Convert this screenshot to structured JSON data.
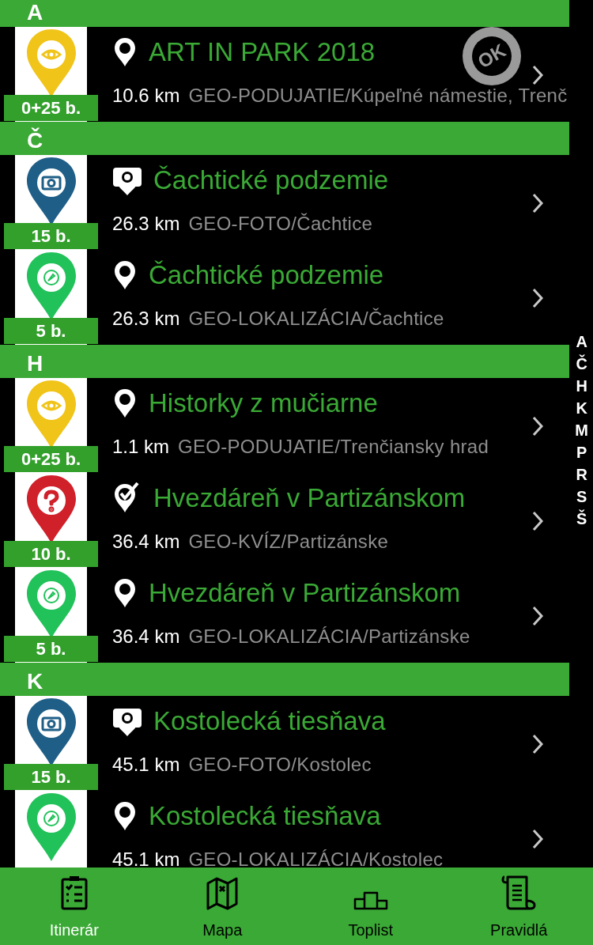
{
  "sections": [
    {
      "letter": "A",
      "items": [
        {
          "kind": "event",
          "points": "0+25 b.",
          "title": "ART IN PARK 2018",
          "distance": "10.6 km",
          "category": "GEO-PODUJATIE/Kúpeľné námestie, Trenč",
          "stamp": "OK"
        }
      ]
    },
    {
      "letter": "Č",
      "items": [
        {
          "kind": "photo",
          "points": "15 b.",
          "title": "Čachtické podzemie",
          "distance": "26.3 km",
          "category": "GEO-FOTO/Čachtice"
        },
        {
          "kind": "location",
          "points": "5 b.",
          "title": "Čachtické podzemie",
          "distance": "26.3 km",
          "category": "GEO-LOKALIZÁCIA/Čachtice"
        }
      ]
    },
    {
      "letter": "H",
      "items": [
        {
          "kind": "event",
          "points": "0+25 b.",
          "title": "Historky z mučiarne",
          "distance": "1.1 km",
          "category": "GEO-PODUJATIE/Trenčiansky hrad"
        },
        {
          "kind": "quiz",
          "points": "10 b.",
          "title": "Hvezdáreň v Partizánskom",
          "distance": "36.4 km",
          "category": "GEO-KVÍZ/Partizánske"
        },
        {
          "kind": "location",
          "points": "5 b.",
          "title": "Hvezdáreň v Partizánskom",
          "distance": "36.4 km",
          "category": "GEO-LOKALIZÁCIA/Partizánske"
        }
      ]
    },
    {
      "letter": "K",
      "items": [
        {
          "kind": "photo",
          "points": "15 b.",
          "title": "Kostolecká tiesňava",
          "distance": "45.1 km",
          "category": "GEO-FOTO/Kostolec"
        },
        {
          "kind": "location",
          "title": "Kostolecká tiesňava",
          "distance": "45.1 km",
          "category": "GEO-LOKALIZÁCIA/Kostolec"
        }
      ]
    }
  ],
  "index": [
    "A",
    "Č",
    "H",
    "K",
    "M",
    "P",
    "R",
    "S",
    "Š"
  ],
  "tabs": [
    {
      "kind": "itinerary",
      "label": "Itinerár",
      "selected": true
    },
    {
      "kind": "map",
      "label": "Mapa",
      "selected": false
    },
    {
      "kind": "toplist",
      "label": "Toplist",
      "selected": false
    },
    {
      "kind": "rules",
      "label": "Pravidlá",
      "selected": false
    }
  ]
}
